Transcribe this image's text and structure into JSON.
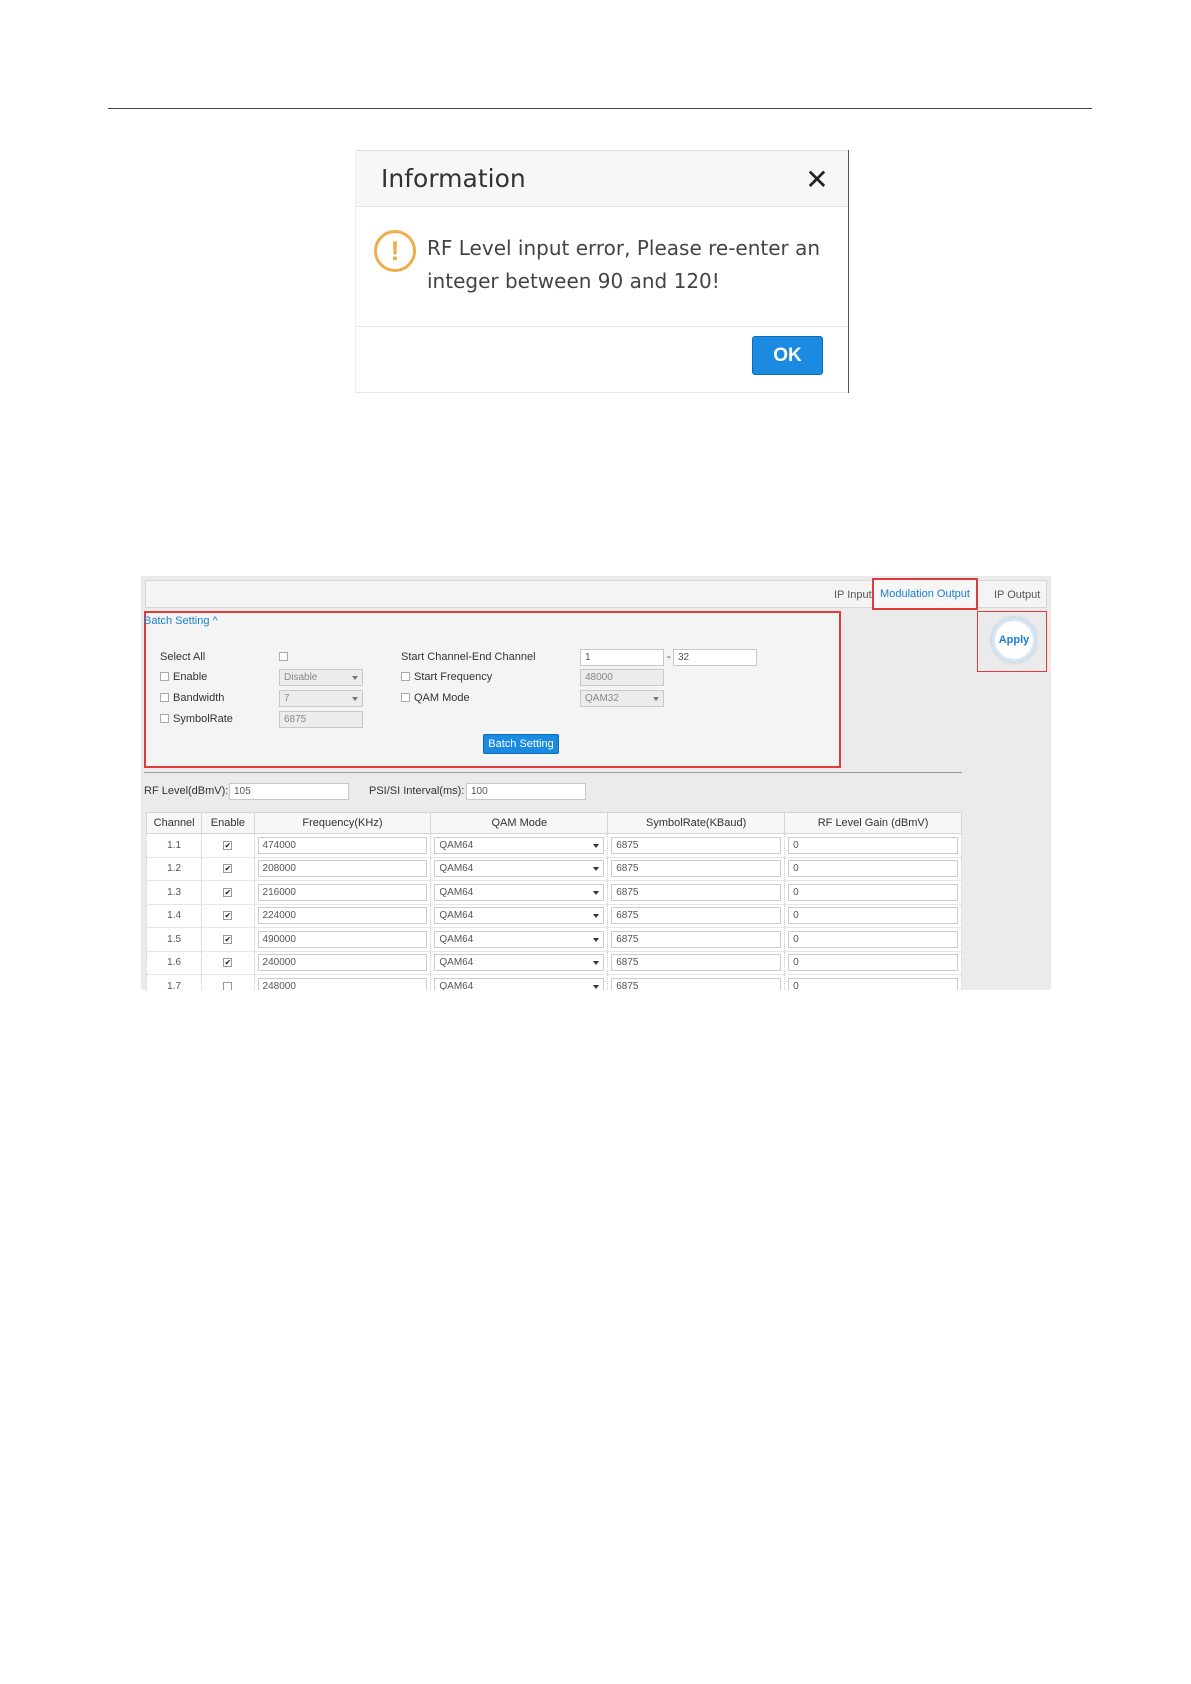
{
  "dialog": {
    "title": "Information",
    "close_glyph": "✕",
    "icon": "warning-icon",
    "icon_glyph": "!",
    "message": "RF Level input error, Please re-enter an integer between 90 and 120!",
    "ok_label": "OK"
  },
  "panel": {
    "tabs": {
      "ip_input": "IP Input",
      "modulation_output": "Modulation Output",
      "ip_output": "IP Output"
    },
    "apply_label": "Apply",
    "batch": {
      "toggle_label": "Batch Setting",
      "toggle_glyph": "^",
      "select_all_label": "Select All",
      "enable_label": "Enable",
      "enable_value": "Disable",
      "bandwidth_label": "Bandwidth",
      "bandwidth_value": "7",
      "symbolrate_label": "SymbolRate",
      "symbolrate_value": "6875",
      "start_end_label": "Start Channel-End Channel",
      "start_channel": "1",
      "range_sep": "-",
      "end_channel": "32",
      "start_freq_label": "Start Frequency",
      "start_freq_value": "48000",
      "qam_mode_label": "QAM Mode",
      "qam_mode_value": "QAM32",
      "button_label": "Batch Setting"
    },
    "rf_level_label": "RF Level(dBmV):",
    "rf_level_value": "105",
    "psi_label": "PSI/SI Interval(ms):",
    "psi_value": "100",
    "table": {
      "headers": [
        "Channel",
        "Enable",
        "Frequency(KHz)",
        "QAM Mode",
        "SymbolRate(KBaud)",
        "RF Level Gain (dBmV)"
      ],
      "rows": [
        {
          "channel": "1.1",
          "enabled": "✔",
          "frequency": "474000",
          "qam": "QAM64",
          "symbolrate": "6875",
          "gain": "0"
        },
        {
          "channel": "1.2",
          "enabled": "✔",
          "frequency": "208000",
          "qam": "QAM64",
          "symbolrate": "6875",
          "gain": "0"
        },
        {
          "channel": "1.3",
          "enabled": "✔",
          "frequency": "216000",
          "qam": "QAM64",
          "symbolrate": "6875",
          "gain": "0"
        },
        {
          "channel": "1.4",
          "enabled": "✔",
          "frequency": "224000",
          "qam": "QAM64",
          "symbolrate": "6875",
          "gain": "0"
        },
        {
          "channel": "1.5",
          "enabled": "✔",
          "frequency": "490000",
          "qam": "QAM64",
          "symbolrate": "6875",
          "gain": "0"
        },
        {
          "channel": "1.6",
          "enabled": "✔",
          "frequency": "240000",
          "qam": "QAM64",
          "symbolrate": "6875",
          "gain": "0"
        },
        {
          "channel": "1.7",
          "enabled": "",
          "frequency": "248000",
          "qam": "QAM64",
          "symbolrate": "6875",
          "gain": "0"
        }
      ]
    }
  },
  "colors": {
    "accent": "#1a8be0",
    "highlight_border": "#e03a3a",
    "warning": "#f0ad4e"
  }
}
